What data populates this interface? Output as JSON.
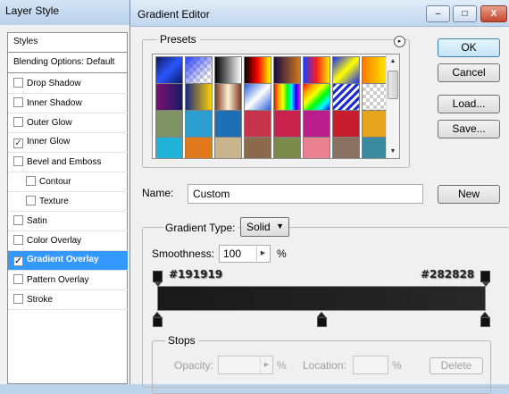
{
  "layer_style": {
    "title": "Layer Style",
    "styles_header": "Styles",
    "blending_options": "Blending Options: Default",
    "items": [
      {
        "label": "Drop Shadow",
        "checked": false
      },
      {
        "label": "Inner Shadow",
        "checked": false
      },
      {
        "label": "Outer Glow",
        "checked": false
      },
      {
        "label": "Inner Glow",
        "checked": true
      },
      {
        "label": "Bevel and Emboss",
        "checked": false
      },
      {
        "label": "Contour",
        "checked": false
      },
      {
        "label": "Texture",
        "checked": false
      },
      {
        "label": "Satin",
        "checked": false
      },
      {
        "label": "Color Overlay",
        "checked": false
      },
      {
        "label": "Gradient Overlay",
        "checked": true
      },
      {
        "label": "Pattern Overlay",
        "checked": false
      },
      {
        "label": "Stroke",
        "checked": false
      }
    ]
  },
  "gradient_editor": {
    "title": "Gradient Editor",
    "window_buttons": {
      "minimize": "–",
      "maximize": "□",
      "close": "X"
    },
    "presets_label": "Presets",
    "presets_menu_icon": "▸",
    "buttons": {
      "ok": "OK",
      "cancel": "Cancel",
      "load": "Load...",
      "save": "Save...",
      "new": "New"
    },
    "name_label": "Name:",
    "name_value": "Custom",
    "gradient_type_label": "Gradient Type:",
    "gradient_type_value": "Solid",
    "smoothness_label": "Smoothness:",
    "smoothness_value": "100",
    "percent": "%",
    "left_color_hex": "#191919",
    "right_color_hex": "#282828",
    "stops_label": "Stops",
    "opacity_label": "Opacity:",
    "location_label": "Location:",
    "delete_button": "Delete"
  },
  "colors": {
    "gradient_start": "#191919",
    "gradient_end": "#282828",
    "selected_row": "#3399ff"
  },
  "presets": [
    [
      "linear-gradient(135deg,#0c1a5a,#2a55ff,#0a1a66)",
      "checker-blue",
      "linear-gradient(90deg,#000,#fff)",
      "linear-gradient(90deg,#000,#f00 50%,#ff0)",
      "linear-gradient(90deg,#160a45,#d27a1c)",
      "linear-gradient(90deg,#1a3cff,#ff1a1a,#ffee00)",
      "linear-gradient(135deg,#1a2bff,#ff0,#1a2bff)",
      "linear-gradient(90deg,#ff7a00,#fff200)"
    ],
    [
      "linear-gradient(90deg,#7a1070,#1a1a66)",
      "linear-gradient(90deg,#1a2a80,#ffd000)",
      "linear-gradient(90deg,#7a3a20,#fff0d0,#7a3a20)",
      "linear-gradient(135deg,#2a5fd8,#ffffff 50%,#2a5fd8)",
      "linear-gradient(90deg,red,orange,yellow,lime,cyan,blue,magenta)",
      "linear-gradient(135deg,red,orange,yellow,lime,cyan,blue)",
      "stripes",
      "checker-grey"
    ],
    [
      "#7f9463",
      "#2b9dcf",
      "#1d6fb6",
      "#c8334c",
      "#c8214b",
      "#b81d8b",
      "#c81d2f",
      "#e6a51f"
    ],
    [
      "#1fb3d9",
      "#e07a1a",
      "#c9b58c",
      "#8a6a4a",
      "#7c8a4c",
      "#e88090",
      "#8a7060",
      "#3a8aa0"
    ]
  ]
}
